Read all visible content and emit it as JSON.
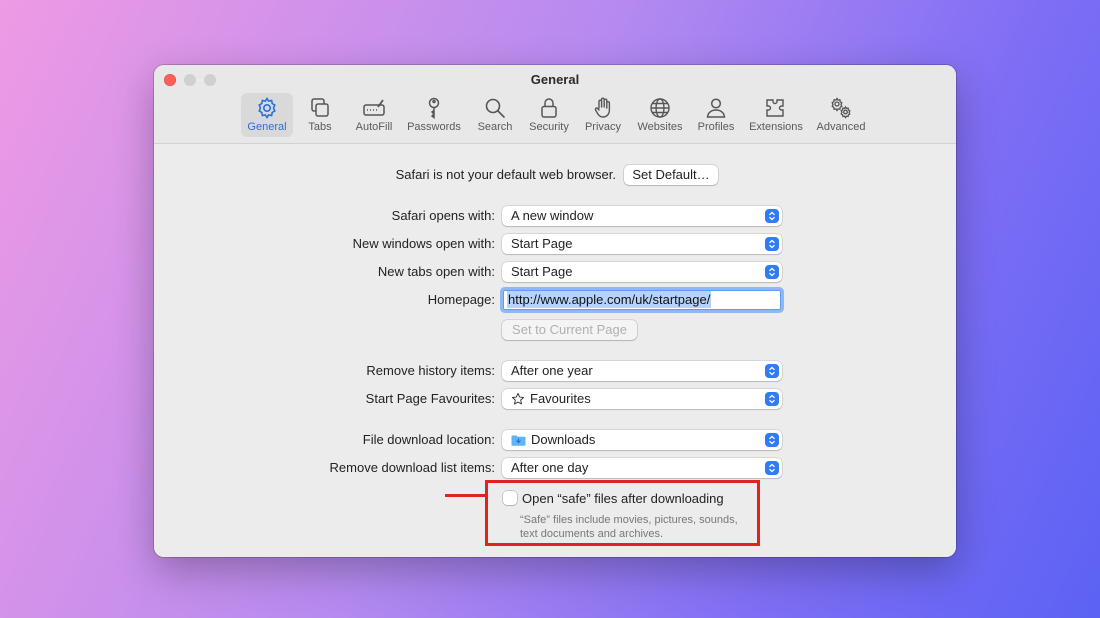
{
  "window": {
    "title": "General"
  },
  "tabs": [
    {
      "label": "General",
      "icon": "gear-icon",
      "active": true
    },
    {
      "label": "Tabs",
      "icon": "tabs-icon"
    },
    {
      "label": "AutoFill",
      "icon": "autofill-icon"
    },
    {
      "label": "Passwords",
      "icon": "key-icon"
    },
    {
      "label": "Search",
      "icon": "search-icon"
    },
    {
      "label": "Security",
      "icon": "lock-icon"
    },
    {
      "label": "Privacy",
      "icon": "hand-icon"
    },
    {
      "label": "Websites",
      "icon": "globe-icon"
    },
    {
      "label": "Profiles",
      "icon": "person-icon"
    },
    {
      "label": "Extensions",
      "icon": "puzzle-icon"
    },
    {
      "label": "Advanced",
      "icon": "gears-icon"
    }
  ],
  "default_browser": {
    "text": "Safari is not your default web browser.",
    "button": "Set Default…"
  },
  "settings": {
    "opens_with": {
      "label": "Safari opens with:",
      "value": "A new window"
    },
    "new_windows": {
      "label": "New windows open with:",
      "value": "Start Page"
    },
    "new_tabs": {
      "label": "New tabs open with:",
      "value": "Start Page"
    },
    "homepage": {
      "label": "Homepage:",
      "value": "http://www.apple.com/uk/startpage/"
    },
    "set_current_page": "Set to Current Page",
    "remove_history": {
      "label": "Remove history items:",
      "value": "After one year"
    },
    "favourites": {
      "label": "Start Page Favourites:",
      "value": "Favourites"
    },
    "download_location": {
      "label": "File download location:",
      "value": "Downloads"
    },
    "remove_downloads": {
      "label": "Remove download list items:",
      "value": "After one day"
    },
    "open_safe": {
      "label": "Open “safe” files after downloading",
      "note_line1": "“Safe” files include movies, pictures, sounds,",
      "note_line2": "text documents and archives.",
      "checked": false
    }
  },
  "help_button": "?",
  "colors": {
    "accent": "#2f7cf6",
    "annotation": "#e02320"
  }
}
